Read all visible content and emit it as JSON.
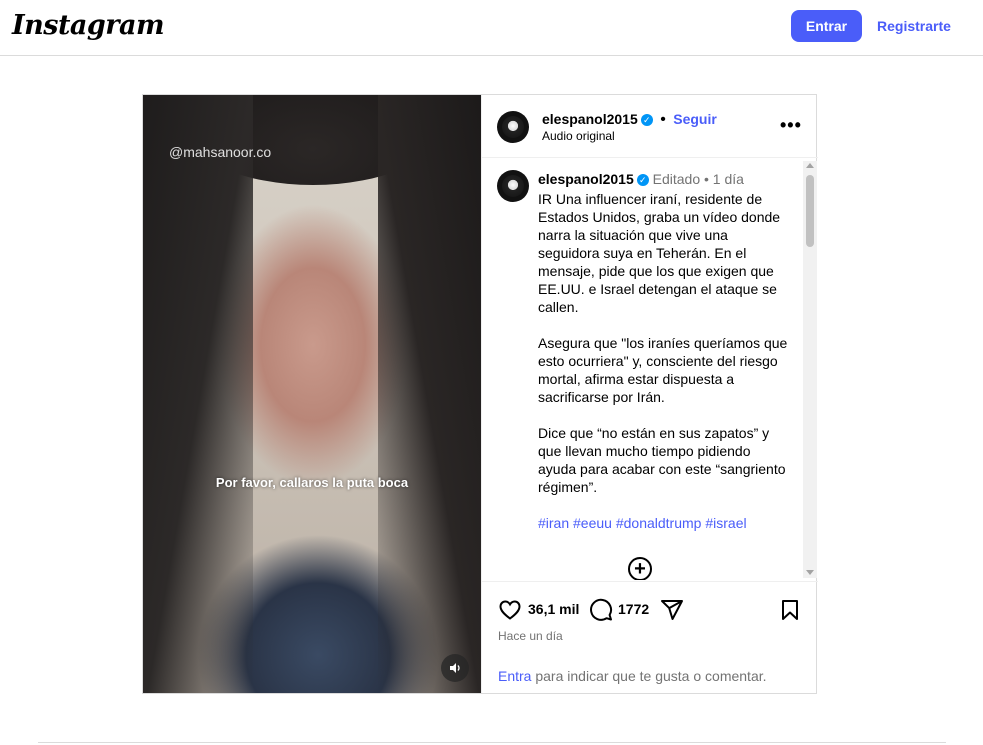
{
  "header": {
    "logo": "Instagram",
    "login_label": "Entrar",
    "register_label": "Registrarte"
  },
  "video": {
    "watermark": "@mahsanoor.co",
    "subtitle": "Por favor, callaros la puta boca"
  },
  "post": {
    "username": "elespanol2015",
    "follow_label": "Seguir",
    "audio_label": "Audio original",
    "caption": {
      "username": "elespanol2015",
      "edited": "Editado",
      "time": "1 día",
      "paragraphs": [
        "IR Una influencer iraní, residente de Estados Unidos, graba un vídeo donde narra la situación que vive una seguidora suya en Teherán. En el mensaje, pide que los que exigen que EE.UU. e Israel detengan el ataque se callen.",
        "Asegura que \"los iraníes queríamos que esto ocurriera\" y, consciente del riesgo mortal, afirma estar dispuesta a sacrificarse por Irán.",
        "Dice que “no están en sus zapatos” y que llevan mucho tiempo pidiendo ayuda para acabar con este “sangriento régimen”."
      ],
      "hashtags": "#iran #eeuu #donaldtrump #israel"
    },
    "likes": "36,1 mil",
    "comments_count": "1772",
    "time_ago": "Hace un día",
    "login_prompt": {
      "link": "Entra",
      "text": "para indicar que te gusta o comentar."
    }
  },
  "colors": {
    "accent": "#4a5df9",
    "verified": "#0095f6",
    "muted": "#737373",
    "border": "#dbdbdb"
  },
  "icons": [
    "more-icon",
    "verified-icon",
    "heart-icon",
    "comment-icon",
    "share-icon",
    "bookmark-icon",
    "add-comment-icon",
    "audio-icon"
  ]
}
